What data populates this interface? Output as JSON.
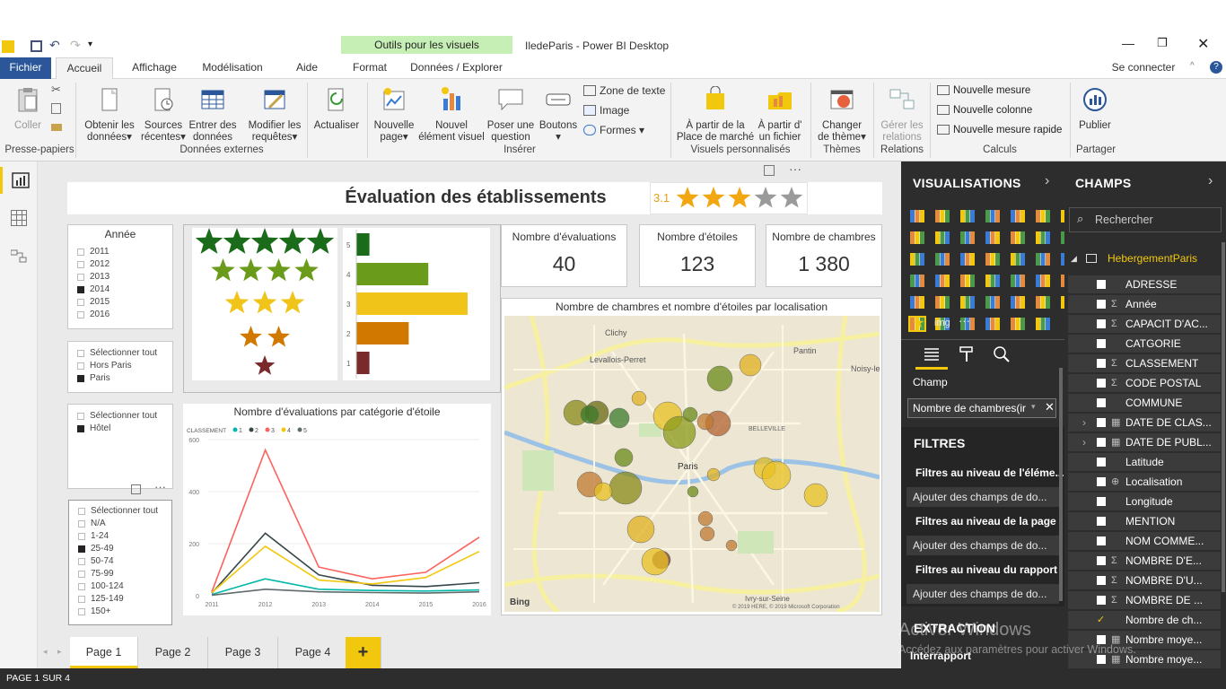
{
  "window": {
    "title": "IledeParis - Power BI Desktop",
    "context_tab": "Outils pour les visuels",
    "sign_in": "Se connecter"
  },
  "menu": {
    "fichier": "Fichier",
    "tabs": [
      "Accueil",
      "Affichage",
      "Modélisation",
      "Aide",
      "Format",
      "Données / Explorer"
    ]
  },
  "ribbon": {
    "coller": "Coller",
    "presse_papiers": "Presse-papiers",
    "obtenir_l1": "Obtenir les",
    "obtenir_l2": "données",
    "sources_l1": "Sources",
    "sources_l2": "récentes",
    "entrer_l1": "Entrer des",
    "entrer_l2": "données",
    "modifier_l1": "Modifier les",
    "modifier_l2": "requêtes",
    "donnees_externes": "Données externes",
    "actualiser": "Actualiser",
    "nouvelle_page_l1": "Nouvelle",
    "nouvelle_page_l2": "page",
    "nouvel_visuel_l1": "Nouvel",
    "nouvel_visuel_l2": "élément visuel",
    "poser_l1": "Poser une",
    "poser_l2": "question",
    "boutons": "Boutons",
    "zone_texte": "Zone de texte",
    "image": "Image",
    "formes": "Formes",
    "inserer": "Insérer",
    "place_l1": "À partir de la",
    "place_l2": "Place de marché",
    "fichier_l1": "À partir d'",
    "fichier_l2": "un fichier",
    "visuels_perso": "Visuels personnalisés",
    "theme_l1": "Changer",
    "theme_l2": "de thème",
    "themes": "Thèmes",
    "relations_l1": "Gérer les",
    "relations_l2": "relations",
    "relations": "Relations",
    "nouvelle_mesure": "Nouvelle mesure",
    "nouvelle_colonne": "Nouvelle colonne",
    "mesure_rapide": "Nouvelle mesure rapide",
    "calculs": "Calculs",
    "publier": "Publier",
    "partager": "Partager"
  },
  "report": {
    "title": "Évaluation des établissements",
    "rating": "3.1",
    "rating_value": 3.1,
    "annee_title": "Année",
    "annee": [
      {
        "label": "2011",
        "checked": false
      },
      {
        "label": "2012",
        "checked": false
      },
      {
        "label": "2013",
        "checked": false
      },
      {
        "label": "2014",
        "checked": true
      },
      {
        "label": "2015",
        "checked": false
      },
      {
        "label": "2016",
        "checked": false
      }
    ],
    "localisation": [
      {
        "label": "Sélectionner tout",
        "checked": false
      },
      {
        "label": "Hors Paris",
        "checked": false
      },
      {
        "label": "Paris",
        "checked": true
      }
    ],
    "type": [
      {
        "label": "Sélectionner tout",
        "checked": false
      },
      {
        "label": "Hôtel",
        "checked": true
      }
    ],
    "capacite": [
      {
        "label": "Sélectionner tout",
        "checked": false
      },
      {
        "label": "N/A",
        "checked": false
      },
      {
        "label": "1-24",
        "checked": false
      },
      {
        "label": "25-49",
        "checked": true
      },
      {
        "label": "50-74",
        "checked": false
      },
      {
        "label": "75-99",
        "checked": false
      },
      {
        "label": "100-124",
        "checked": false
      },
      {
        "label": "125-149",
        "checked": false
      },
      {
        "label": "150+",
        "checked": false
      }
    ],
    "kpi": [
      {
        "label": "Nombre d'évaluations",
        "value": "40"
      },
      {
        "label": "Nombre d'étoiles",
        "value": "123"
      },
      {
        "label": "Nombre de chambres",
        "value": "1 380"
      }
    ],
    "map_title": "Nombre de chambres et nombre d'étoiles par localisation",
    "map_labels": {
      "clichy": "Clichy",
      "levallois": "Levallois-Perret",
      "pantin": "Pantin",
      "noisy": "Noisy-le",
      "paris": "Paris",
      "belleville": "BELLEVILLE",
      "bing": "Bing",
      "copyright": "© 2019 HERE, © 2019 Microsoft Corporation",
      "ivry": "Ivry-sur-Seine"
    },
    "line_title": "Nombre d'évaluations par catégorie d'étoile",
    "legend_title": "CLASSEMENT",
    "colors": {
      "c1": "#01b8aa",
      "c2": "#374649",
      "c3": "#fd625e",
      "c4": "#f2c80f",
      "c5": "#5f6b6d",
      "star5": "#1a6b1a",
      "star4": "#6a9b1a",
      "star3": "#f0c419",
      "star2": "#d07800",
      "star1": "#7a2a2a"
    }
  },
  "chart_data": [
    {
      "type": "bar",
      "orientation": "horizontal",
      "categories": [
        "5",
        "4",
        "3",
        "2",
        "1"
      ],
      "values": [
        2,
        11,
        17,
        8,
        2
      ]
    },
    {
      "type": "line",
      "title": "Nombre d'évaluations par catégorie d'étoile",
      "legend_title": "CLASSEMENT",
      "x": [
        "2011",
        "2012",
        "2013",
        "2014",
        "2015",
        "2016"
      ],
      "ylim": [
        0,
        600
      ],
      "yticks": [
        "0",
        "200",
        "400",
        "600"
      ],
      "series": [
        {
          "name": "1",
          "values": [
            5,
            65,
            25,
            20,
            18,
            22
          ]
        },
        {
          "name": "2",
          "values": [
            10,
            240,
            80,
            40,
            35,
            50
          ]
        },
        {
          "name": "3",
          "values": [
            15,
            560,
            110,
            65,
            90,
            225
          ]
        },
        {
          "name": "4",
          "values": [
            12,
            190,
            60,
            45,
            70,
            170
          ]
        },
        {
          "name": "5",
          "values": [
            2,
            25,
            15,
            12,
            10,
            15
          ]
        }
      ]
    }
  ],
  "pages": {
    "tabs": [
      "Page 1",
      "Page 2",
      "Page 3",
      "Page 4"
    ],
    "add": "+",
    "status": "PAGE 1 SUR 4"
  },
  "viz_pane": {
    "title": "VISUALISATIONS",
    "img_label": "img",
    "more": "···",
    "champ_label": "Champ",
    "champ_value": "Nombre de chambres(ir",
    "filtres": "FILTRES",
    "f_element": "Filtres au niveau de l'éléme...",
    "f_add1": "Ajouter des champs de do...",
    "f_page": "Filtres au niveau de la page",
    "f_add2": "Ajouter des champs de do...",
    "f_rapport": "Filtres au niveau du rapport",
    "f_add3": "Ajouter des champs de do...",
    "extraction": "EXTRACTION",
    "interrapport": "Interrapport"
  },
  "fields_pane": {
    "title": "CHAMPS",
    "search_placeholder": "Rechercher",
    "table": "HebergementParis",
    "fields": [
      {
        "name": "ADRESSE",
        "sigma": "",
        "checked": false
      },
      {
        "name": "Année",
        "sigma": "Σ",
        "checked": false
      },
      {
        "name": "CAPACIT D'AC...",
        "sigma": "Σ",
        "checked": false
      },
      {
        "name": "CATGORIE",
        "sigma": "",
        "checked": false
      },
      {
        "name": "CLASSEMENT",
        "sigma": "Σ",
        "checked": false
      },
      {
        "name": "CODE POSTAL",
        "sigma": "Σ",
        "checked": false
      },
      {
        "name": "COMMUNE",
        "sigma": "",
        "checked": false
      },
      {
        "name": "DATE DE CLAS...",
        "sigma": "▦",
        "checked": false
      },
      {
        "name": "DATE DE PUBL...",
        "sigma": "▦",
        "checked": false
      },
      {
        "name": "Latitude",
        "sigma": "",
        "checked": false
      },
      {
        "name": "Localisation",
        "sigma": "⊕",
        "checked": false
      },
      {
        "name": "Longitude",
        "sigma": "",
        "checked": false
      },
      {
        "name": "MENTION",
        "sigma": "",
        "checked": false
      },
      {
        "name": "NOM COMME...",
        "sigma": "",
        "checked": false
      },
      {
        "name": "NOMBRE D'E...",
        "sigma": "Σ",
        "checked": false
      },
      {
        "name": "NOMBRE D'U...",
        "sigma": "Σ",
        "checked": false
      },
      {
        "name": "NOMBRE DE ...",
        "sigma": "Σ",
        "checked": false
      },
      {
        "name": "Nombre de ch...",
        "sigma": "",
        "checked": true
      },
      {
        "name": "Nombre moye...",
        "sigma": "▦",
        "checked": false
      },
      {
        "name": "Nombre moye...",
        "sigma": "▦",
        "checked": false
      }
    ]
  },
  "watermark": {
    "line1": "Activer Windows",
    "line2": "Accédez aux paramètres pour activer Windows."
  }
}
